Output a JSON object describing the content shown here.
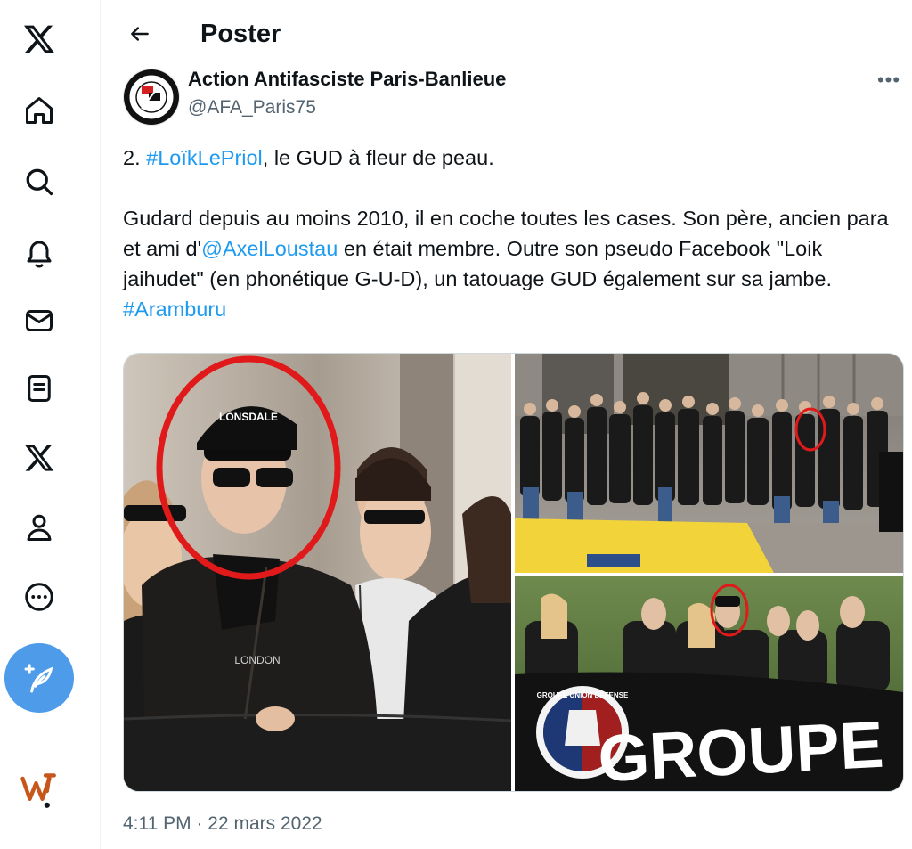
{
  "colors": {
    "accent": "#1d9bf0",
    "compose": "#4d9be9",
    "muted": "#536471",
    "text": "#0f1419"
  },
  "nav": [
    {
      "icon": "x-logo-icon"
    },
    {
      "icon": "home-icon"
    },
    {
      "icon": "search-icon"
    },
    {
      "icon": "bell-icon"
    },
    {
      "icon": "mail-icon"
    },
    {
      "icon": "lists-icon"
    },
    {
      "icon": "x-premium-icon"
    },
    {
      "icon": "profile-icon"
    },
    {
      "icon": "more-icon"
    }
  ],
  "header": {
    "title": "Poster"
  },
  "author": {
    "name": "Action Antifasciste Paris-Banlieue",
    "handle": "@AFA_Paris75",
    "avatar_text": "ACTION ANTIFASCISTE · PARIS-BANLIEUE"
  },
  "tweet": {
    "p1_prefix": "2. ",
    "p1_hashtag": "#LoïkLePriol",
    "p1_suffix": ", le GUD à fleur de peau.",
    "p2_part1": "Gudard depuis au moins 2010, il en coche toutes les cases. Son père, ancien para et ami d'",
    "p2_mention": "@AxelLoustau",
    "p2_part2": " en était membre. Outre son pseudo Facebook \"Loik jaihudet\" (en phonétique G-U-D), un tatouage GUD également sur sa jambe. ",
    "p2_hashtag": "#Aramburu"
  },
  "media": {
    "photo1_cap_text": "LONSDALE",
    "photo1_shirt_text": "LONDON",
    "photo3_banner_text": "GROUPE U",
    "photo3_badge_text": "GROUPE UNION DEFENSE"
  },
  "timestamp": "4:11 PM · 22 mars 2022"
}
